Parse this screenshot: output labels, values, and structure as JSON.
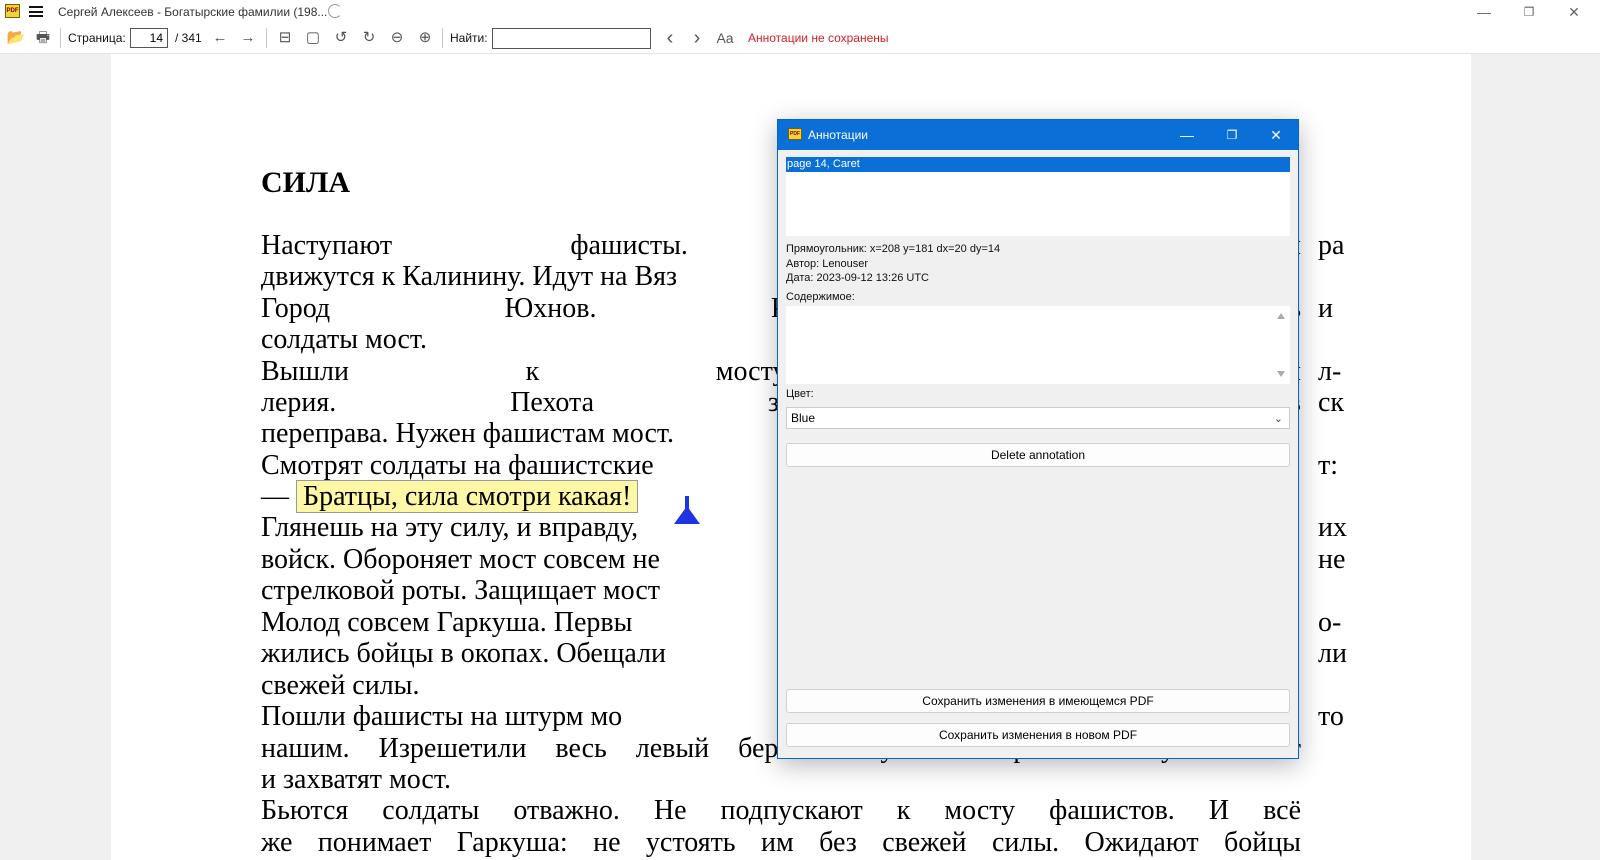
{
  "window": {
    "title": "Сергей Алексеев - Богатырские фамилии (198...",
    "app_icon_text": "PDF",
    "minimize_glyph": "—",
    "maximize_glyph": "❐",
    "close_glyph": "✕"
  },
  "toolbar": {
    "open_icon": "📂",
    "print_icon": "🖶",
    "page_label": "Страница:",
    "page_value": "14",
    "page_total": "/ 341",
    "back_icon": "←",
    "forward_icon": "→",
    "fit_width_icon": "⊟",
    "fit_page_icon": "▢",
    "rotate_left_icon": "↺",
    "rotate_right_icon": "↻",
    "zoom_out_icon": "⊖",
    "zoom_in_icon": "⊕",
    "find_label": "Найти:",
    "find_value": "",
    "find_prev_icon": "‹",
    "find_next_icon": "›",
    "font_icon": "Aa",
    "annotation_status": "Аннотации не сохранены",
    "status_color": "#d4202a"
  },
  "document": {
    "heading": "СИЛА",
    "lines": [
      "    Наступают фашисты. С юга и",
      "движутся к Калинину. Идут на Вяз",
      "    Город Юхнов. Река Угра. Здесь",
      "солдаты мост.",
      "    Вышли к мосту фашисты. Тан",
      "лерия. Пехота забила весь прав",
      "переправа. Нужен фашистам мост.",
      "    Смотрят солдаты на фашистские",
      "    Глянешь на эту силу, и вправду,",
      "войск. Обороняет мост совсем не",
      "стрелковой роты. Защищает мост",
      "    Молод совсем Гаркуша. Первы",
      "жились бойцы в окопах. Обещали",
      "свежей силы.",
      "    Пошли фашисты на штурм мо",
      "нашим. Изрешетили весь левый берег. Несутся теперь в атаку. Вот-вот",
      "и захватят мост.",
      "    Бьются солдаты отважно. Не подпускают к мосту фашистов. И всё",
      "же понимает Гаркуша: не устоять им без свежей силы. Ожидают бойцы"
    ],
    "right_fragments": [
      "ра",
      "и",
      "л-",
      "ск",
      "т:",
      "их",
      "не",
      "о-",
      "ли",
      "то"
    ],
    "dash": "—",
    "highlighted_text": "Братцы, сила смотри какая!",
    "highlight_color": "#fdf7a6",
    "caret_color": "#1f33e0"
  },
  "dialog": {
    "title": "Аннотации",
    "selected_item": "page 14, Caret",
    "rect_info": "Прямоугольник: x=208 y=181 dx=20 dy=14",
    "author": "Автор: Lenouser",
    "date": "Дата: 2023-09-12 13:26 UTC",
    "content_label": "Содержимое:",
    "content_value": "",
    "color_label": "Цвет:",
    "color_value": "Blue",
    "delete_button": "Delete annotation",
    "save_existing_button": "Сохранить изменения в имеющемся PDF",
    "save_new_button": "Сохранить изменения в новом PDF"
  }
}
